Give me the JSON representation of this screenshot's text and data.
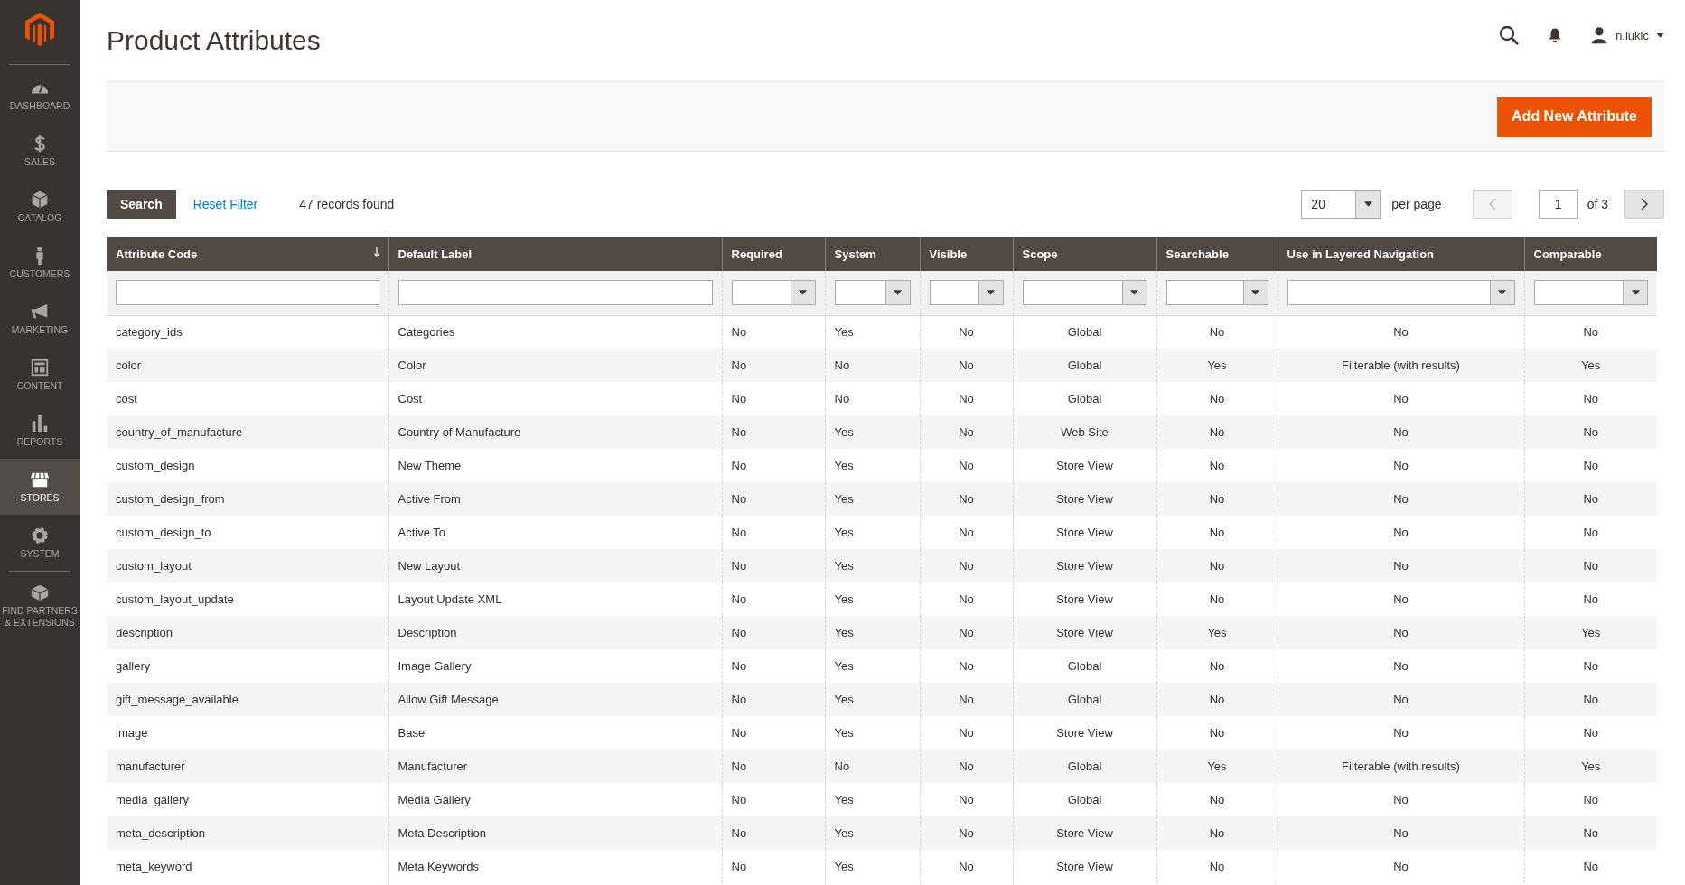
{
  "sidebar": {
    "items": [
      {
        "label": "DASHBOARD",
        "selected": false
      },
      {
        "label": "SALES",
        "selected": false
      },
      {
        "label": "CATALOG",
        "selected": false
      },
      {
        "label": "CUSTOMERS",
        "selected": false
      },
      {
        "label": "MARKETING",
        "selected": false
      },
      {
        "label": "CONTENT",
        "selected": false
      },
      {
        "label": "REPORTS",
        "selected": false
      },
      {
        "label": "STORES",
        "selected": true
      },
      {
        "label": "SYSTEM",
        "selected": false
      },
      {
        "label": "FIND PARTNERS & EXTENSIONS",
        "selected": false
      }
    ]
  },
  "page_title": "Product Attributes",
  "user": {
    "name": "n.lukic"
  },
  "add_button": "Add New Attribute",
  "toolbar": {
    "search_button": "Search",
    "reset_link": "Reset Filter",
    "records": "47 records found",
    "per_page_value": "20",
    "per_page_label": "per page",
    "page": "1",
    "of_pages": "of 3"
  },
  "table": {
    "columns": [
      {
        "label": "Attribute Code",
        "kind": "text",
        "sorted": true
      },
      {
        "label": "Default Label",
        "kind": "text",
        "sorted": false
      },
      {
        "label": "Required",
        "kind": "select",
        "sorted": false
      },
      {
        "label": "System",
        "kind": "select",
        "sorted": false
      },
      {
        "label": "Visible",
        "kind": "select",
        "sorted": false
      },
      {
        "label": "Scope",
        "kind": "select",
        "sorted": false
      },
      {
        "label": "Searchable",
        "kind": "select",
        "sorted": false
      },
      {
        "label": "Use in Layered Navigation",
        "kind": "select",
        "sorted": false
      },
      {
        "label": "Comparable",
        "kind": "select",
        "sorted": false
      }
    ],
    "rows": [
      [
        "category_ids",
        "Categories",
        "No",
        "Yes",
        "No",
        "Global",
        "No",
        "No",
        "No"
      ],
      [
        "color",
        "Color",
        "No",
        "No",
        "No",
        "Global",
        "Yes",
        "Filterable (with results)",
        "Yes"
      ],
      [
        "cost",
        "Cost",
        "No",
        "No",
        "No",
        "Global",
        "No",
        "No",
        "No"
      ],
      [
        "country_of_manufacture",
        "Country of Manufacture",
        "No",
        "Yes",
        "No",
        "Web Site",
        "No",
        "No",
        "No"
      ],
      [
        "custom_design",
        "New Theme",
        "No",
        "Yes",
        "No",
        "Store View",
        "No",
        "No",
        "No"
      ],
      [
        "custom_design_from",
        "Active From",
        "No",
        "Yes",
        "No",
        "Store View",
        "No",
        "No",
        "No"
      ],
      [
        "custom_design_to",
        "Active To",
        "No",
        "Yes",
        "No",
        "Store View",
        "No",
        "No",
        "No"
      ],
      [
        "custom_layout",
        "New Layout",
        "No",
        "Yes",
        "No",
        "Store View",
        "No",
        "No",
        "No"
      ],
      [
        "custom_layout_update",
        "Layout Update XML",
        "No",
        "Yes",
        "No",
        "Store View",
        "No",
        "No",
        "No"
      ],
      [
        "description",
        "Description",
        "No",
        "Yes",
        "No",
        "Store View",
        "Yes",
        "No",
        "Yes"
      ],
      [
        "gallery",
        "Image Gallery",
        "No",
        "Yes",
        "No",
        "Global",
        "No",
        "No",
        "No"
      ],
      [
        "gift_message_available",
        "Allow Gift Message",
        "No",
        "Yes",
        "No",
        "Global",
        "No",
        "No",
        "No"
      ],
      [
        "image",
        "Base",
        "No",
        "Yes",
        "No",
        "Store View",
        "No",
        "No",
        "No"
      ],
      [
        "manufacturer",
        "Manufacturer",
        "No",
        "No",
        "No",
        "Global",
        "Yes",
        "Filterable (with results)",
        "Yes"
      ],
      [
        "media_gallery",
        "Media Gallery",
        "No",
        "Yes",
        "No",
        "Global",
        "No",
        "No",
        "No"
      ],
      [
        "meta_description",
        "Meta Description",
        "No",
        "Yes",
        "No",
        "Store View",
        "No",
        "No",
        "No"
      ],
      [
        "meta_keyword",
        "Meta Keywords",
        "No",
        "Yes",
        "No",
        "Store View",
        "No",
        "No",
        "No"
      ]
    ]
  }
}
